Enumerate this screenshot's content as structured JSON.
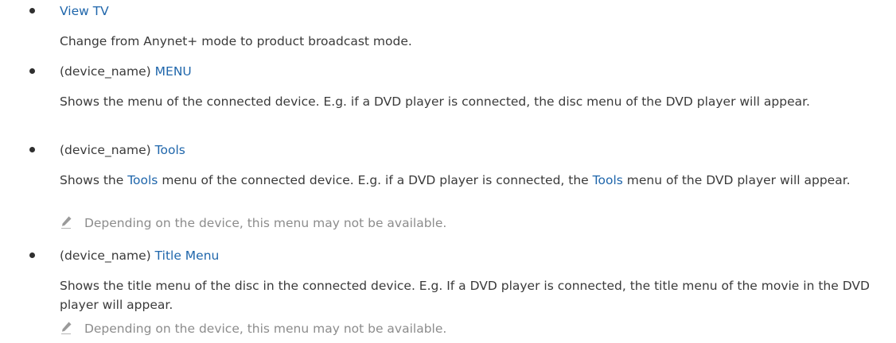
{
  "items": [
    {
      "prefix": "",
      "name": "View TV",
      "description": "Change from Anynet+ mode to product broadcast mode."
    },
    {
      "prefix": "(device_name)",
      "name": "MENU",
      "description": "Shows the menu of the connected device. E.g. if a DVD player is connected, the disc menu of the DVD player will appear."
    },
    {
      "prefix": "(device_name)",
      "name": "Tools",
      "description_part1": "Shows the",
      "description_keyword1": "Tools",
      "description_part2": "menu of the connected device. E.g. if a DVD player is connected, the",
      "description_keyword2": "Tools",
      "description_part3": "menu of the DVD player will appear.",
      "note": "Depending on the device, this menu may not be available."
    },
    {
      "prefix": "(device_name)",
      "name": "Title Menu",
      "description": "Shows the title menu of the disc in the connected device. E.g. If a DVD player is connected, the title menu of the movie in the DVD player will appear.",
      "note": "Depending on the device, this menu may not be available."
    }
  ],
  "note_icon": "pencil-note-icon",
  "colors": {
    "accent": "#1f66ab",
    "text": "#3a3a3a",
    "note": "#8c8c8c"
  }
}
